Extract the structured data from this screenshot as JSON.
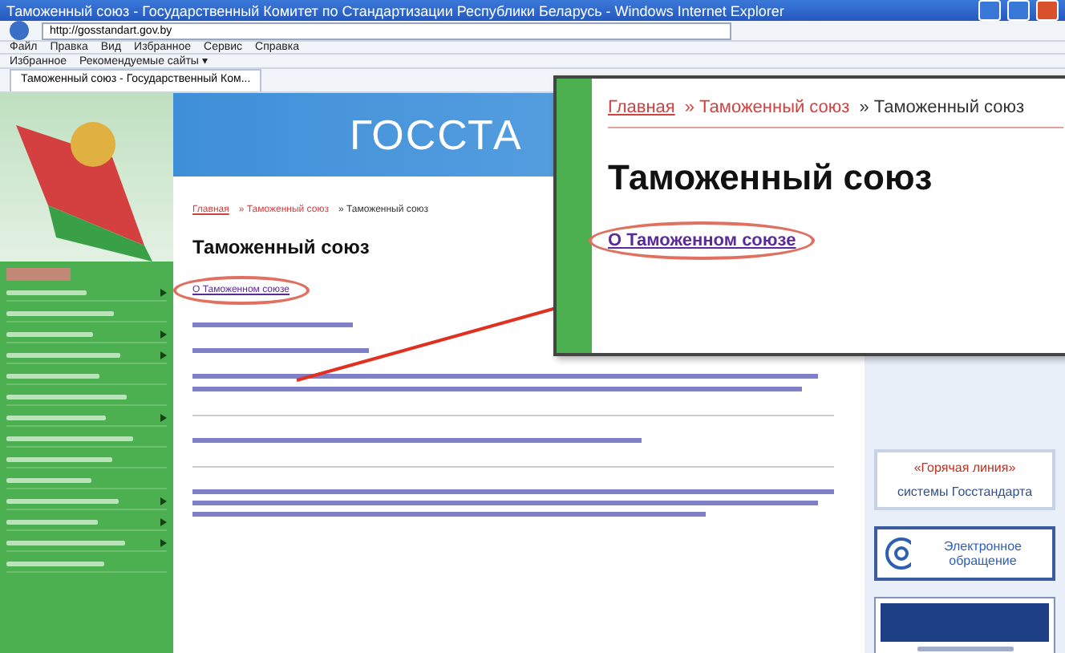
{
  "window": {
    "title": "Таможенный союз - Государственный Комитет по Стандартизации Республики Беларусь - Windows Internet Explorer"
  },
  "address_bar": {
    "value": "http://gosstandart.gov.by"
  },
  "menu": [
    "Файл",
    "Правка",
    "Вид",
    "Избранное",
    "Сервис",
    "Справка"
  ],
  "favorites_bar": [
    "Избранное",
    "Рекомендуемые сайты ▾"
  ],
  "tab": {
    "label": "Таможенный союз - Государственный Ком..."
  },
  "site": {
    "logo": "ГОССТА",
    "sidebar_items": [
      {
        "expandable": true
      },
      {
        "expandable": false
      },
      {
        "expandable": true
      },
      {
        "expandable": true
      },
      {
        "expandable": false
      },
      {
        "expandable": false
      },
      {
        "expandable": true
      },
      {
        "expandable": false
      },
      {
        "expandable": false
      },
      {
        "expandable": false
      },
      {
        "expandable": true
      },
      {
        "expandable": true
      },
      {
        "expandable": true
      },
      {
        "expandable": false
      }
    ],
    "breadcrumb": [
      {
        "label": "Главная",
        "kind": "link"
      },
      {
        "label": "» Таможенный союз",
        "kind": "link"
      },
      {
        "label": "» Таможенный союз",
        "kind": "current"
      }
    ],
    "heading": "Таможенный союз",
    "link": {
      "text": "О Таможенном союзе",
      "circled": true
    },
    "hotline": {
      "title": "«Горячая линия»",
      "subtitle": "системы Госстандарта"
    },
    "e_appeal": {
      "label": "Электронное обращение"
    }
  },
  "callout": {
    "breadcrumb": [
      {
        "label": "Главная",
        "kind": "link"
      },
      {
        "label": "» Таможенный союз",
        "kind": "link"
      },
      {
        "label": "» Таможенный союз",
        "kind": "current"
      }
    ],
    "heading": "Таможенный союз",
    "link": {
      "text": "О Таможенном союзе",
      "circled": true
    }
  }
}
